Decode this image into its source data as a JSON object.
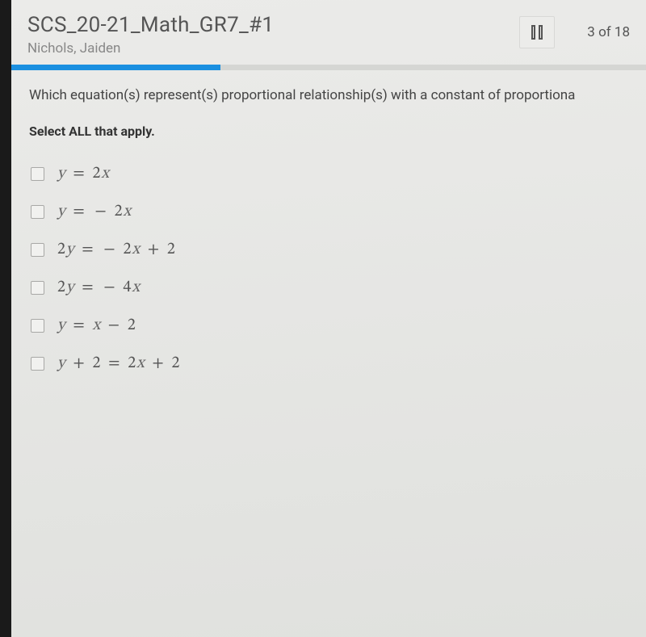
{
  "header": {
    "title": "SCS_20-21_Math_GR7_#1",
    "subtitle": "Nichols, Jaiden",
    "counter": "3 of 18",
    "progress_percent": 33
  },
  "question": {
    "prompt": "Which equation(s) represent(s) proportional relationship(s) with a constant of proportiona",
    "instruction": "Select ALL that apply.",
    "options": [
      {
        "display": "y = 2x"
      },
      {
        "display": "y = − 2x"
      },
      {
        "display": "2y = − 2x + 2"
      },
      {
        "display": "2y = − 4x"
      },
      {
        "display": "y = x − 2"
      },
      {
        "display": "y + 2 = 2x + 2"
      }
    ]
  }
}
